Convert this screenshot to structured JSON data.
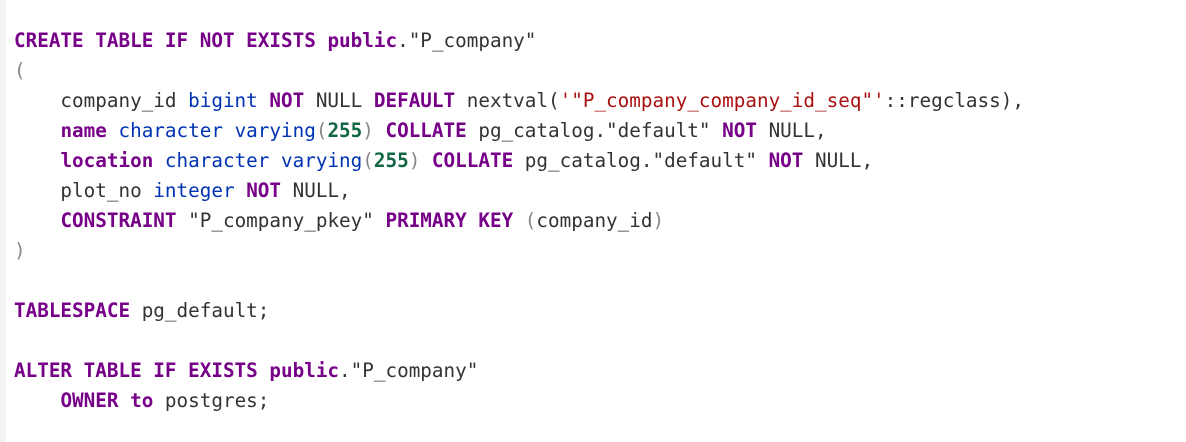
{
  "theme": {
    "background": "#ffffff",
    "keyword": "#770088",
    "type": "#0033b3",
    "string": "#aa1111",
    "number": "#116644",
    "plain": "#333333",
    "punctuation": "#888888"
  },
  "code_lines": [
    [
      [
        "kw",
        "CREATE TABLE IF NOT EXISTS"
      ],
      [
        "plain",
        " "
      ],
      [
        "kw",
        "public"
      ],
      [
        "plain",
        "."
      ],
      [
        "plain",
        "\"P_company\""
      ]
    ],
    [
      [
        "punct",
        "("
      ]
    ],
    [
      [
        "plain",
        "    company_id "
      ],
      [
        "type",
        "bigint"
      ],
      [
        "plain",
        " "
      ],
      [
        "kw",
        "NOT"
      ],
      [
        "plain",
        " NULL "
      ],
      [
        "kw",
        "DEFAULT"
      ],
      [
        "plain",
        " nextval("
      ],
      [
        "str",
        "'\"P_company_company_id_seq\"'"
      ],
      [
        "plain",
        "::regclass),"
      ]
    ],
    [
      [
        "plain",
        "    "
      ],
      [
        "kw",
        "name"
      ],
      [
        "plain",
        " "
      ],
      [
        "type",
        "character varying"
      ],
      [
        "punct",
        "("
      ],
      [
        "num",
        "255"
      ],
      [
        "punct",
        ")"
      ],
      [
        "plain",
        " "
      ],
      [
        "kw",
        "COLLATE"
      ],
      [
        "plain",
        " pg_catalog.\"default\" "
      ],
      [
        "kw",
        "NOT"
      ],
      [
        "plain",
        " NULL,"
      ]
    ],
    [
      [
        "plain",
        "    "
      ],
      [
        "kw",
        "location"
      ],
      [
        "plain",
        " "
      ],
      [
        "type",
        "character varying"
      ],
      [
        "punct",
        "("
      ],
      [
        "num",
        "255"
      ],
      [
        "punct",
        ")"
      ],
      [
        "plain",
        " "
      ],
      [
        "kw",
        "COLLATE"
      ],
      [
        "plain",
        " pg_catalog.\"default\" "
      ],
      [
        "kw",
        "NOT"
      ],
      [
        "plain",
        " NULL,"
      ]
    ],
    [
      [
        "plain",
        "    plot_no "
      ],
      [
        "type",
        "integer"
      ],
      [
        "plain",
        " "
      ],
      [
        "kw",
        "NOT"
      ],
      [
        "plain",
        " NULL,"
      ]
    ],
    [
      [
        "plain",
        "    "
      ],
      [
        "kw",
        "CONSTRAINT"
      ],
      [
        "plain",
        " \"P_company_pkey\" "
      ],
      [
        "kw",
        "PRIMARY KEY"
      ],
      [
        "plain",
        " "
      ],
      [
        "punct",
        "("
      ],
      [
        "plain",
        "company_id"
      ],
      [
        "punct",
        ")"
      ]
    ],
    [
      [
        "punct",
        ")"
      ]
    ],
    [],
    [
      [
        "kw",
        "TABLESPACE"
      ],
      [
        "plain",
        " pg_default;"
      ]
    ],
    [],
    [
      [
        "kw",
        "ALTER TABLE IF EXISTS"
      ],
      [
        "plain",
        " "
      ],
      [
        "kw",
        "public"
      ],
      [
        "plain",
        "."
      ],
      [
        "plain",
        "\"P_company\""
      ]
    ],
    [
      [
        "plain",
        "    "
      ],
      [
        "kw",
        "OWNER"
      ],
      [
        "plain",
        " "
      ],
      [
        "kw",
        "to"
      ],
      [
        "plain",
        " postgres;"
      ]
    ]
  ]
}
